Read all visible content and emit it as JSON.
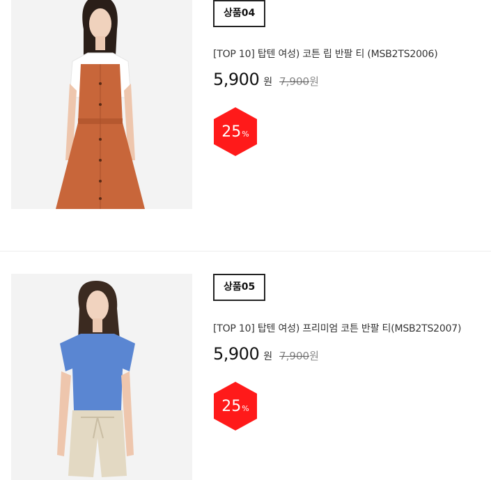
{
  "products": [
    {
      "tag": "상품04",
      "name": "[TOP 10] 탑텐 여성) 코튼 립 반팔 티 (MSB2TS2006)",
      "price": "5,900",
      "currency": "원",
      "original_price": "7,900",
      "original_currency": "원",
      "discount_number": "25",
      "discount_unit": "%",
      "badge_color": "#ff1a1a"
    },
    {
      "tag": "상품05",
      "name": "[TOP 10] 탑텐 여성) 프리미엄 코튼 반팔 티(MSB2TS2007)",
      "price": "5,900",
      "currency": "원",
      "original_price": "7,900",
      "original_currency": "원",
      "discount_number": "25",
      "discount_unit": "%",
      "badge_color": "#ff1a1a"
    }
  ]
}
